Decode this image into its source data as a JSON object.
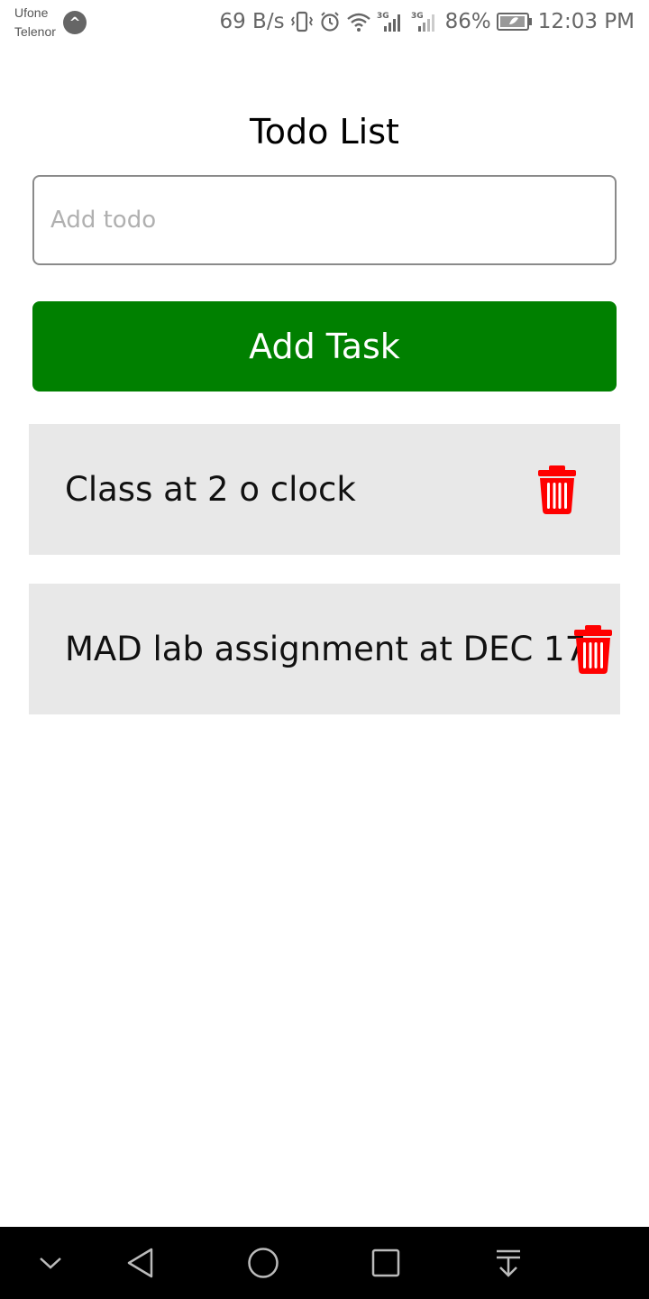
{
  "status_bar": {
    "carrier_1": "Ufone",
    "carrier_2": "Telenor",
    "carrier_badge_icon": "arrow-up-circle-icon",
    "net_speed": "69 B/s",
    "network_1": "3G",
    "network_2": "3G",
    "battery_percent": "86%",
    "time": "12:03 PM"
  },
  "header": {
    "title": "Todo List"
  },
  "input": {
    "placeholder": "Add todo",
    "value": ""
  },
  "add_button": {
    "label": "Add Task",
    "color": "#008000"
  },
  "todos": [
    {
      "text": "Class at 2 o clock",
      "delete_icon": "trash-icon"
    },
    {
      "text": "MAD lab assignment at DEC 17",
      "delete_icon": "trash-icon"
    }
  ],
  "colors": {
    "delete_icon": "#ff0000",
    "item_background": "#e8e8e8"
  },
  "nav_bar": {
    "icons": [
      "chevron-down-icon",
      "back-icon",
      "home-icon",
      "recents-icon",
      "notification-pull-icon"
    ]
  }
}
